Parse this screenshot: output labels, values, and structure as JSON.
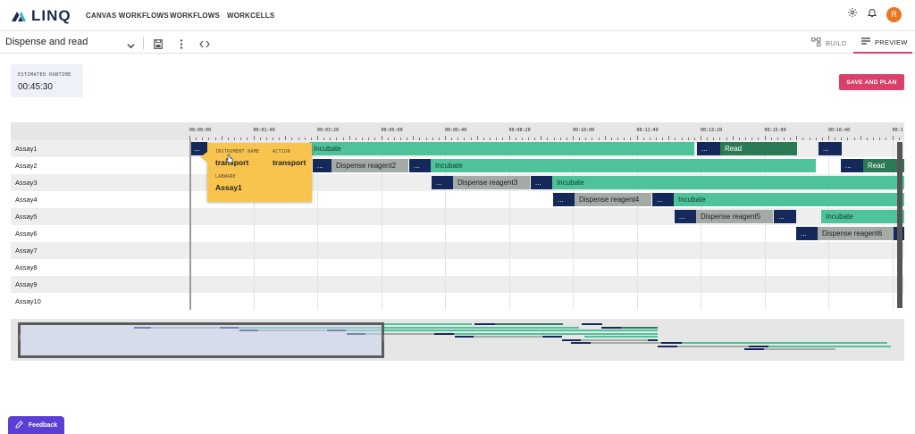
{
  "app": {
    "logo_text": "LINQ"
  },
  "nav": {
    "items": [
      "CANVAS WORKFLOWS",
      "WORKFLOWS",
      "WORKCELLS"
    ]
  },
  "user": {
    "avatar_initial": "R"
  },
  "toolbar": {
    "workflow_name": "Dispense and read",
    "build_label": "BUILD",
    "preview_label": "PREVIEW"
  },
  "runtime": {
    "label": "ESTIMATED RUNTIME",
    "value": "00:45:30"
  },
  "actions": {
    "save_and_plan": "SAVE AND PLAN"
  },
  "timeline": {
    "ticks": [
      "00:00:00",
      "00:01:40",
      "00:03:20",
      "00:05:00",
      "00:06:40",
      "00:08:20",
      "00:10:00",
      "00:11:40",
      "00:13:20",
      "00:15:00",
      "00:16:40",
      "00:1"
    ],
    "rows": [
      "Assay1",
      "Assay2",
      "Assay3",
      "Assay4",
      "Assay5",
      "Assay6",
      "Assay7",
      "Assay8",
      "Assay9",
      "Assay10"
    ],
    "bars": [
      {
        "row": 0,
        "start": 0,
        "end": 20,
        "kind": "dark",
        "label": "..."
      },
      {
        "row": 0,
        "start": 134,
        "end": 565,
        "kind": "green",
        "label": "Incubate"
      },
      {
        "row": 0,
        "start": 568,
        "end": 594,
        "kind": "dark",
        "label": "..."
      },
      {
        "row": 0,
        "start": 594,
        "end": 680,
        "kind": "darkgreen",
        "label": "Read"
      },
      {
        "row": 0,
        "start": 704,
        "end": 730,
        "kind": "dark",
        "label": "..."
      },
      {
        "row": 1,
        "start": 138,
        "end": 159,
        "kind": "dark",
        "label": "..."
      },
      {
        "row": 1,
        "start": 159,
        "end": 245,
        "kind": "gray",
        "label": "Dispense reagent2"
      },
      {
        "row": 1,
        "start": 246,
        "end": 270,
        "kind": "dark",
        "label": "..."
      },
      {
        "row": 1,
        "start": 270,
        "end": 701,
        "kind": "green",
        "label": "Incubate"
      },
      {
        "row": 1,
        "start": 729,
        "end": 754,
        "kind": "dark",
        "label": "..."
      },
      {
        "row": 1,
        "start": 754,
        "end": 800,
        "kind": "darkgreen",
        "label": "Read"
      },
      {
        "row": 2,
        "start": 271,
        "end": 295,
        "kind": "dark",
        "label": "..."
      },
      {
        "row": 2,
        "start": 295,
        "end": 381,
        "kind": "gray",
        "label": "Dispense reagent3"
      },
      {
        "row": 2,
        "start": 382,
        "end": 406,
        "kind": "dark",
        "label": "..."
      },
      {
        "row": 2,
        "start": 406,
        "end": 800,
        "kind": "green",
        "label": "Incubate"
      },
      {
        "row": 3,
        "start": 407,
        "end": 431,
        "kind": "dark",
        "label": "..."
      },
      {
        "row": 3,
        "start": 431,
        "end": 517,
        "kind": "gray",
        "label": "Dispense reagent4"
      },
      {
        "row": 3,
        "start": 518,
        "end": 542,
        "kind": "dark",
        "label": "..."
      },
      {
        "row": 3,
        "start": 542,
        "end": 800,
        "kind": "green",
        "label": "Incubate"
      },
      {
        "row": 4,
        "start": 543,
        "end": 567,
        "kind": "dark",
        "label": "..."
      },
      {
        "row": 4,
        "start": 567,
        "end": 653,
        "kind": "gray",
        "label": "Dispense reagent5"
      },
      {
        "row": 4,
        "start": 654,
        "end": 679,
        "kind": "dark",
        "label": "..."
      },
      {
        "row": 4,
        "start": 707,
        "end": 800,
        "kind": "green",
        "label": "Incubate"
      },
      {
        "row": 5,
        "start": 679,
        "end": 703,
        "kind": "dark",
        "label": "..."
      },
      {
        "row": 5,
        "start": 703,
        "end": 788,
        "kind": "gray",
        "label": "Dispense reagent6"
      },
      {
        "row": 5,
        "start": 788,
        "end": 800,
        "kind": "dark",
        "label": ""
      }
    ]
  },
  "tooltip": {
    "instrument_label": "INSTRUMENT NAME",
    "instrument_value": "transport",
    "action_label": "ACTION",
    "action_value": "transport",
    "labware_label": "LABWARE",
    "labware_value": "Assay1"
  },
  "feedback": {
    "label": "Feedback"
  },
  "colors": {
    "dark": "#14295a",
    "green": "#4ec39a",
    "gray": "#a4aaa6",
    "read": "#2a7a56",
    "accent": "#d9416b",
    "feedback": "#5b3fd4"
  }
}
